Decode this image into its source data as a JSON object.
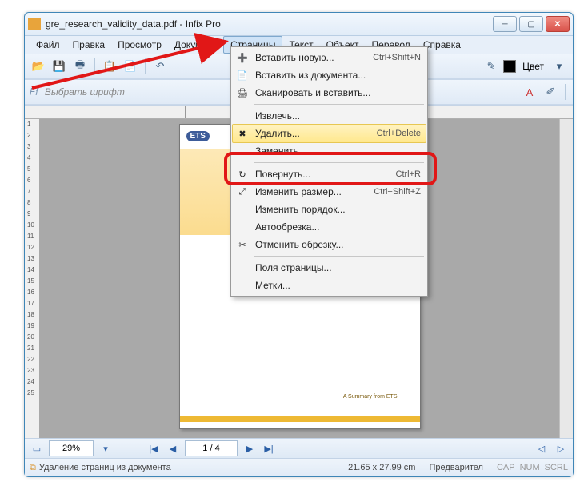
{
  "window": {
    "title": "gre_research_validity_data.pdf - Infix Pro"
  },
  "menubar": {
    "items": [
      "Файл",
      "Правка",
      "Просмотр",
      "Документ",
      "Страницы",
      "Текст",
      "Объект",
      "Перевод",
      "Справка"
    ],
    "active_index": 4
  },
  "toolbar": {
    "font_placeholder": "Выбрать шрифт",
    "color_label": "Цвет"
  },
  "dropdown": {
    "items": [
      {
        "icon": "➕",
        "label": "Вставить новую...",
        "shortcut": "Ctrl+Shift+N"
      },
      {
        "icon": "📄",
        "label": "Вставить из документа..."
      },
      {
        "icon": "🖨",
        "label": "Сканировать и вставить..."
      },
      {
        "sep": true
      },
      {
        "label": "Извлечь..."
      },
      {
        "icon": "✖",
        "label": "Удалить...",
        "shortcut": "Ctrl+Delete",
        "highlighted": true
      },
      {
        "label": "Заменить..."
      },
      {
        "sep": true
      },
      {
        "icon": "↻",
        "label": "Повернуть...",
        "shortcut": "Ctrl+R"
      },
      {
        "icon": "⤢",
        "label": "Изменить размер...",
        "shortcut": "Ctrl+Shift+Z"
      },
      {
        "label": "Изменить порядок..."
      },
      {
        "label": "Автообрезка..."
      },
      {
        "icon": "✂",
        "label": "Отменить обрезку..."
      },
      {
        "sep": true
      },
      {
        "label": "Поля страницы..."
      },
      {
        "label": "Метки..."
      }
    ]
  },
  "page": {
    "logo": "ETS",
    "summary_text": "A Summary from ETS"
  },
  "ruler": {
    "marks": [
      "1",
      "2",
      "3",
      "4",
      "5",
      "6",
      "7",
      "8",
      "9",
      "10",
      "11",
      "12",
      "13",
      "14",
      "15",
      "16",
      "17",
      "18",
      "19",
      "20",
      "21",
      "22",
      "23",
      "24",
      "25"
    ]
  },
  "nav": {
    "zoom": "29%",
    "page_display": "1 / 4"
  },
  "status": {
    "message": "Удаление страниц из документа",
    "dims": "21.65 x 27.99 cm",
    "preview": "Предварител",
    "cap": "CAP",
    "num": "NUM",
    "scrl": "SCRL"
  }
}
